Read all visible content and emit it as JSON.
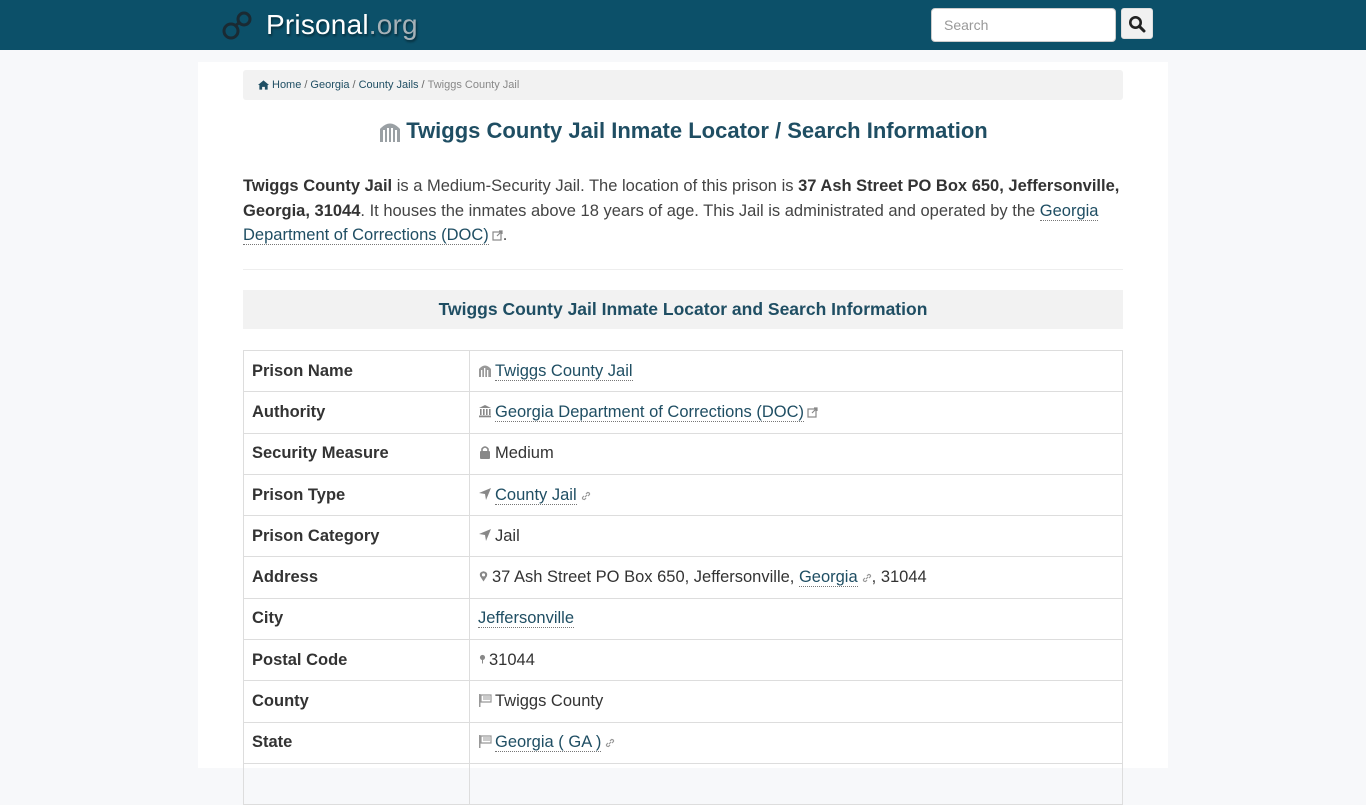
{
  "header": {
    "brand_name": "Prisonal",
    "brand_tld": ".org",
    "search_placeholder": "Search",
    "search_value": ""
  },
  "breadcrumb": {
    "items": [
      {
        "label": "Home",
        "icon": "home-icon",
        "link": true
      },
      {
        "label": "Georgia",
        "link": true
      },
      {
        "label": "County Jails",
        "link": true
      },
      {
        "label": "Twiggs County Jail",
        "link": false
      }
    ],
    "separator": "/"
  },
  "page": {
    "title": "Twiggs County Jail Inmate Locator / Search Information",
    "title_icon": "prison-gate-icon"
  },
  "intro": {
    "facility_name": "Twiggs County Jail",
    "text_1": " is a Medium-Security Jail. The location of this prison is ",
    "address_bold": "37 Ash Street PO Box 650, Jeffersonville, Georgia, 31044",
    "text_2": ". It houses the inmates above 18 years of age. This Jail is administrated and operated by the ",
    "authority_link": "Georgia Department of Corrections (DOC)",
    "text_3": "."
  },
  "section": {
    "heading": "Twiggs County Jail Inmate Locator and Search Information"
  },
  "table": {
    "rows": [
      {
        "label": "Prison Name",
        "value": "Twiggs County Jail",
        "icon": "prison-gate-icon",
        "link": true
      },
      {
        "label": "Authority",
        "value": "Georgia Department of Corrections (DOC)",
        "icon": "institution-icon",
        "link": true,
        "external": true
      },
      {
        "label": "Security Measure",
        "value": "Medium",
        "icon": "lock-icon",
        "link": false
      },
      {
        "label": "Prison Type",
        "value": "County Jail",
        "icon": "location-arrow-icon",
        "link": true,
        "chain": true
      },
      {
        "label": "Prison Category",
        "value": "Jail",
        "icon": "location-arrow-icon",
        "link": false
      },
      {
        "label": "Address",
        "value_prefix": "37 Ash Street PO Box 650, Jeffersonville, ",
        "value_link": "Georgia",
        "value_suffix": ", 31044",
        "icon": "map-marker-icon"
      },
      {
        "label": "City",
        "value": "Jeffersonville",
        "link": true
      },
      {
        "label": "Postal Code",
        "value": "31044",
        "icon": "map-pin-icon",
        "link": false
      },
      {
        "label": "County",
        "value": "Twiggs County",
        "icon": "flag-icon",
        "link": false
      },
      {
        "label": "State",
        "value": "Georgia ( GA )",
        "icon": "flag-icon",
        "link": true,
        "chain": true
      }
    ]
  },
  "colors": {
    "navbar": "#0c5069",
    "heading": "#1f4e63",
    "link": "#1f4e63",
    "panel": "#f2f2f2"
  }
}
